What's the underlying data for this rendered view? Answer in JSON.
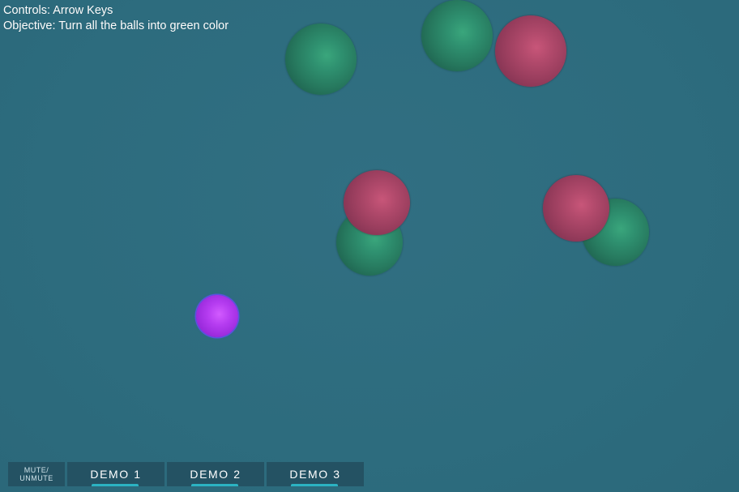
{
  "hud": {
    "controls": "Controls: Arrow Keys",
    "objective": "Objective: Turn all the balls into green color"
  },
  "colors": {
    "background": "#2e6e80",
    "green_ball": "#2f9170",
    "red_ball": "#b24a6c",
    "player_ball": "#b53cf0",
    "button_bg": "#245263",
    "underline": "#2bb3c2"
  },
  "buttons": {
    "mute_line1": "MUTE/",
    "mute_line2": "UNMUTE",
    "demos": [
      "DEMO 1",
      "DEMO 2",
      "DEMO 3"
    ]
  }
}
